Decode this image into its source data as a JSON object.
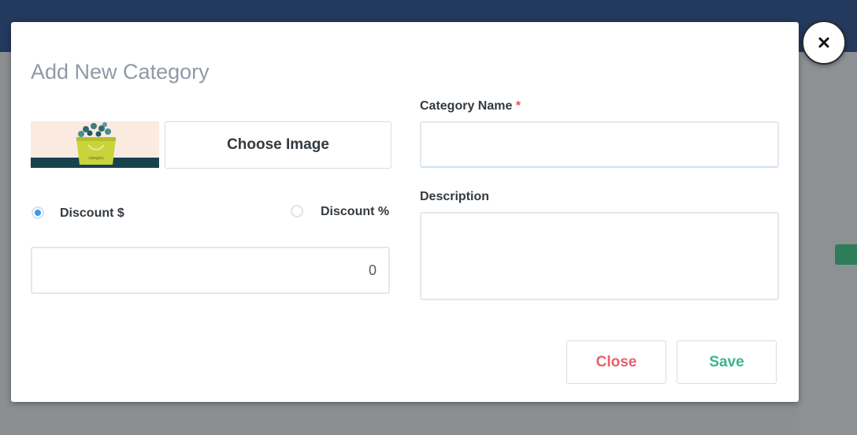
{
  "modal": {
    "title": "Add New Category",
    "choose_image_label": "Choose Image",
    "thumbnail_caption": "category",
    "discount_fixed_label": "Discount $",
    "discount_percent_label": "Discount %",
    "discount_selected": "fixed",
    "discount_value": "0",
    "category_name_label": "Category Name",
    "required_marker": "*",
    "category_name_value": "",
    "description_label": "Description",
    "description_value": "",
    "close_label": "Close",
    "save_label": "Save"
  },
  "colors": {
    "title": "#8f9aa6",
    "close_text": "#e9606a",
    "save_text": "#3cb58a",
    "radio_checked": "#3d9be9",
    "required": "#e0555b"
  },
  "icons": {
    "dismiss": "close-icon",
    "thumbnail": "category-bag-image"
  }
}
